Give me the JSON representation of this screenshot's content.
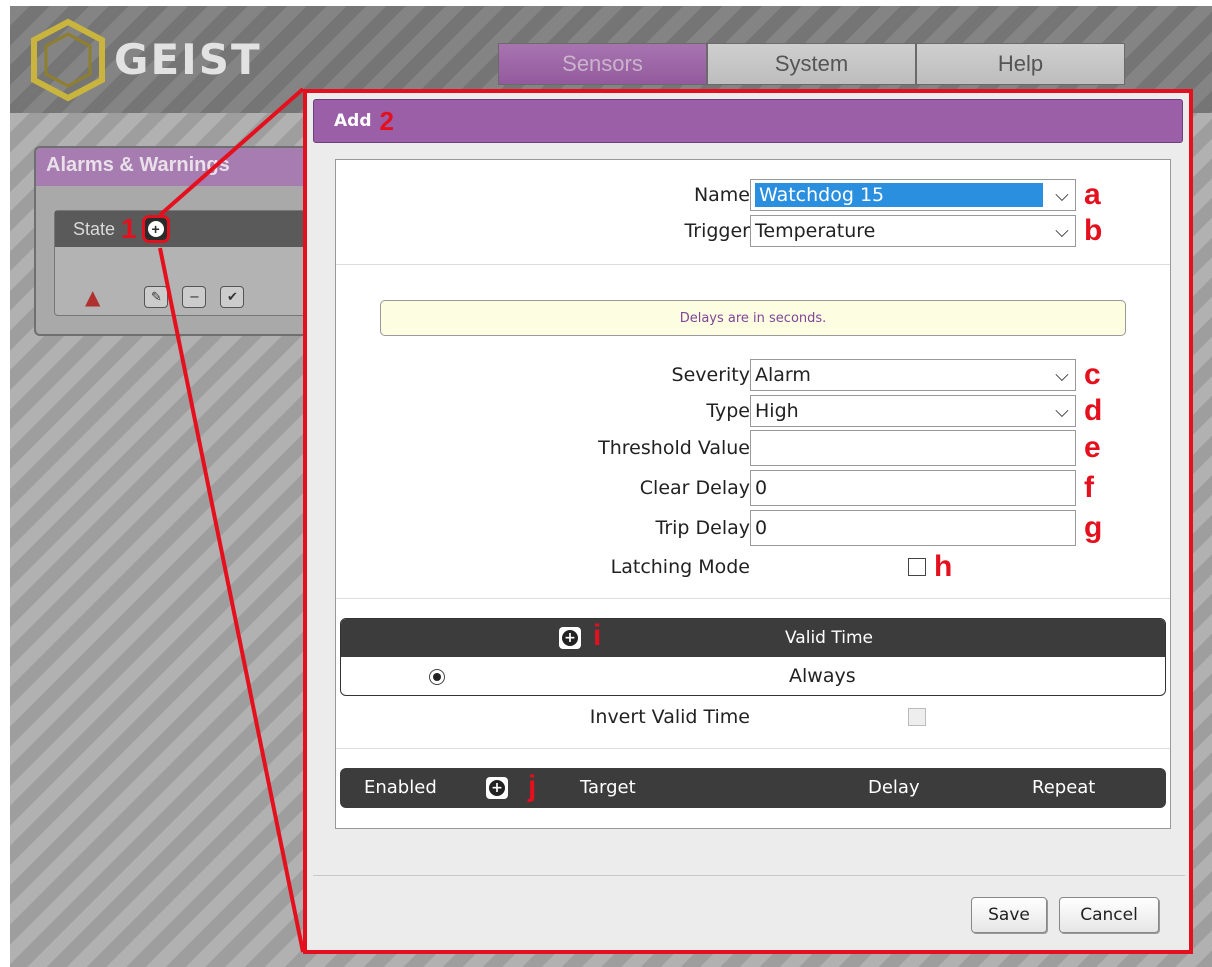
{
  "app": {
    "logo_text": "GEIST",
    "tabs": [
      {
        "label": "Sensors"
      },
      {
        "label": "System"
      },
      {
        "label": "Help"
      }
    ]
  },
  "alarms_panel": {
    "title": "Alarms & Warnings",
    "state_header": "State",
    "annotation": "1"
  },
  "dialog": {
    "title": "Add",
    "title_annotation": "2",
    "name": {
      "label": "Name",
      "value": "Watchdog 15",
      "annotation": "a"
    },
    "trigger": {
      "label": "Trigger",
      "value": "Temperature",
      "annotation": "b"
    },
    "note": "Delays are in seconds.",
    "severity": {
      "label": "Severity",
      "value": "Alarm",
      "annotation": "c"
    },
    "type": {
      "label": "Type",
      "value": "High",
      "annotation": "d"
    },
    "threshold": {
      "label": "Threshold Value",
      "value": "",
      "annotation": "e"
    },
    "clear_delay": {
      "label": "Clear Delay",
      "value": "0",
      "annotation": "f"
    },
    "trip_delay": {
      "label": "Trip Delay",
      "value": "0",
      "annotation": "g"
    },
    "latching": {
      "label": "Latching Mode",
      "annotation": "h"
    },
    "valid_time": {
      "header": "Valid Time",
      "annotation": "i",
      "row_value": "Always"
    },
    "invert_valid_time": {
      "label": "Invert Valid Time"
    },
    "actions_table": {
      "annotation": "j",
      "columns": [
        "Enabled",
        "Target",
        "Delay",
        "Repeat"
      ]
    },
    "buttons": {
      "save": "Save",
      "cancel": "Cancel"
    }
  },
  "colors": {
    "accent_purple": "#9b5fa8",
    "annotation_red": "#e4101d",
    "selection_blue": "#2a8fde"
  }
}
